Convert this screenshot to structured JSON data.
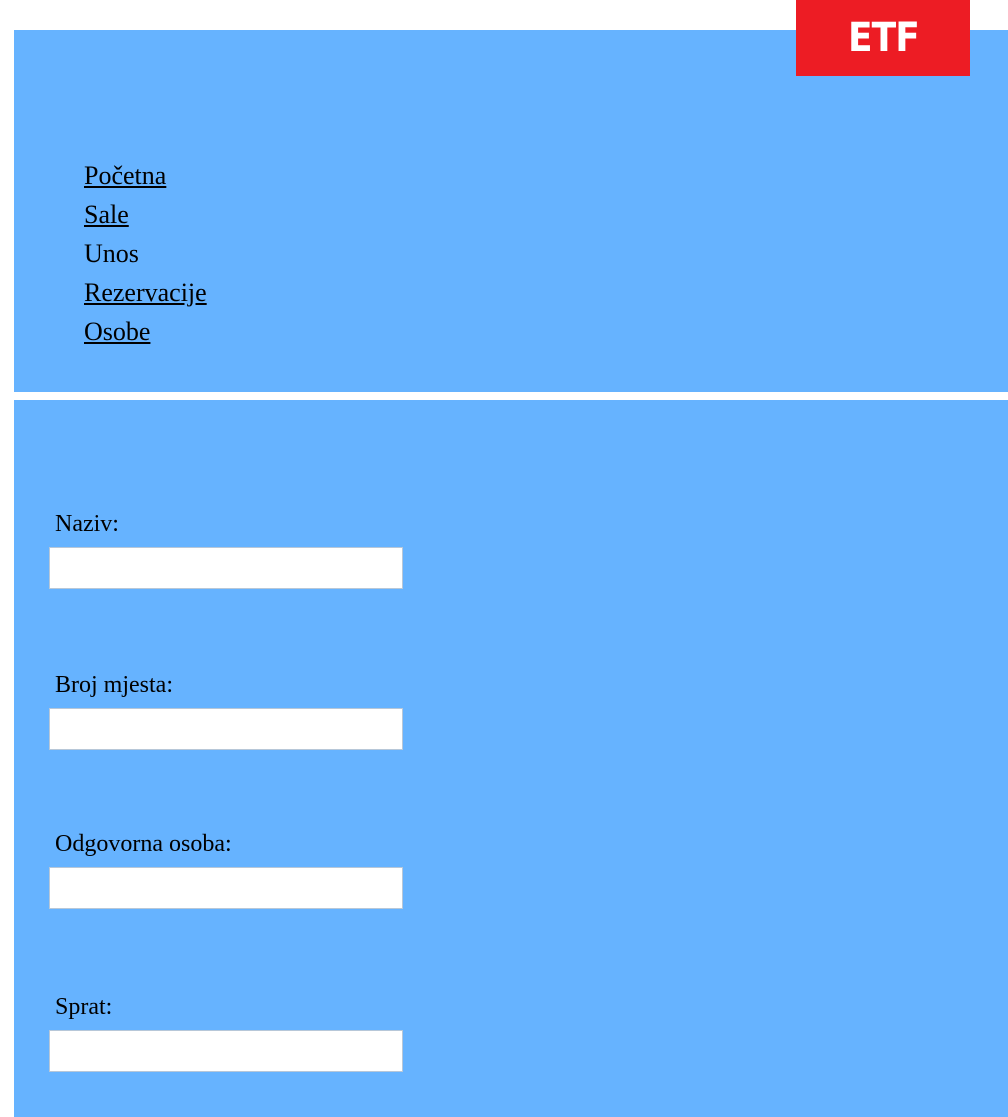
{
  "logo": {
    "text": "ETF",
    "color": "#ed1c24"
  },
  "colors": {
    "background": "#66b3ff"
  },
  "nav": {
    "items": [
      {
        "label": "Početna",
        "link": true
      },
      {
        "label": "Sale",
        "link": true
      },
      {
        "label": "Unos",
        "link": false
      },
      {
        "label": "Rezervacije",
        "link": true
      },
      {
        "label": "Osobe",
        "link": true
      }
    ]
  },
  "form": {
    "naziv": {
      "label": "Naziv:",
      "value": ""
    },
    "broj_mjesta": {
      "label": "Broj mjesta:",
      "value": ""
    },
    "odgovorna_osoba": {
      "label": "Odgovorna osoba:",
      "value": ""
    },
    "sprat": {
      "label": "Sprat:",
      "value": ""
    }
  }
}
